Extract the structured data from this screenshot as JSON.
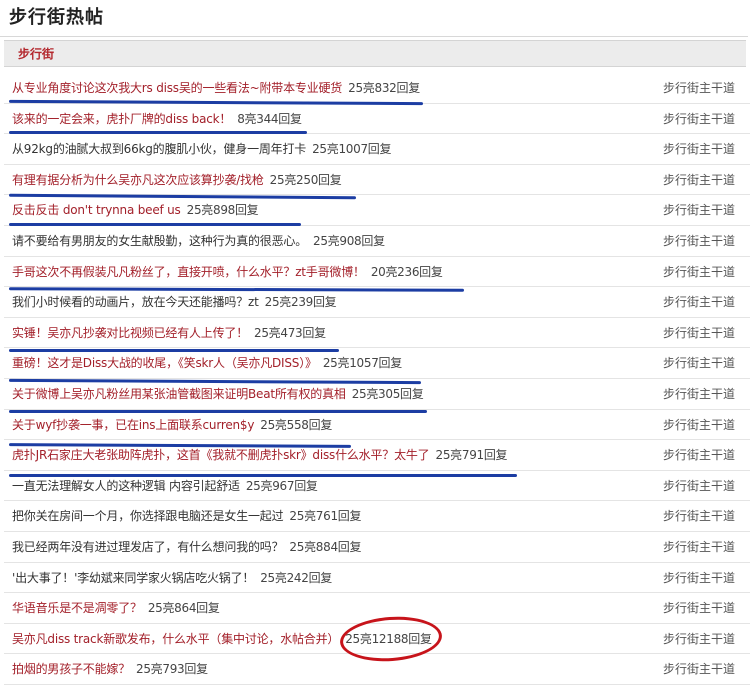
{
  "page": {
    "title": "步行街热帖"
  },
  "section": {
    "label": "步行街"
  },
  "posts": [
    {
      "title": "从专业角度讨论这次我大rs diss吴的一些看法~附带本专业硬货",
      "meta": "25亮832回复",
      "board": "步行街主干道",
      "color": "red"
    },
    {
      "title": "该来的一定会来，虎扑厂牌的diss back！",
      "meta": "8亮344回复",
      "board": "步行街主干道",
      "color": "red"
    },
    {
      "title": "从92kg的油腻大叔到66kg的腹肌小伙，健身一周年打卡",
      "meta": "25亮1007回复",
      "board": "步行街主干道",
      "color": "dark"
    },
    {
      "title": "有理有据分析为什么吴亦凡这次应该算抄袭/找枪",
      "meta": "25亮250回复",
      "board": "步行街主干道",
      "color": "red"
    },
    {
      "title": "反击反击 don't trynna beef us",
      "meta": "25亮898回复",
      "board": "步行街主干道",
      "color": "red"
    },
    {
      "title": "请不要给有男朋友的女生献殷勤，这种行为真的很恶心。",
      "meta": "25亮908回复",
      "board": "步行街主干道",
      "color": "dark"
    },
    {
      "title": "手哥这次不再假装凡凡粉丝了，直接开喷，什么水平？zt手哥微博！",
      "meta": "20亮236回复",
      "board": "步行街主干道",
      "color": "red"
    },
    {
      "title": "我们小时候看的动画片，放在今天还能播吗？zt",
      "meta": "25亮239回复",
      "board": "步行街主干道",
      "color": "dark"
    },
    {
      "title": "实锤！吴亦凡抄袭对比视频已经有人上传了！",
      "meta": "25亮473回复",
      "board": "步行街主干道",
      "color": "red"
    },
    {
      "title": "重磅！这才是Diss大战的收尾，《笑skr人（吴亦凡DISS）》",
      "meta": "25亮1057回复",
      "board": "步行街主干道",
      "color": "red"
    },
    {
      "title": "关于微博上吴亦凡粉丝用某张油管截图来证明Beat所有权的真相",
      "meta": "25亮305回复",
      "board": "步行街主干道",
      "color": "red"
    },
    {
      "title": "关于wyf抄袭一事，已在ins上面联系curren$y",
      "meta": "25亮558回复",
      "board": "步行街主干道",
      "color": "red"
    },
    {
      "title": "虎扑JR石家庄大老张助阵虎扑，这首《我就不删虎扑skr》diss什么水平？太牛了",
      "meta": "25亮791回复",
      "board": "步行街主干道",
      "color": "red"
    },
    {
      "title": "一直无法理解女人的这种逻辑 内容引起舒适",
      "meta": "25亮967回复",
      "board": "步行街主干道",
      "color": "dark"
    },
    {
      "title": "把你关在房间一个月，你选择跟电脑还是女生一起过",
      "meta": "25亮761回复",
      "board": "步行街主干道",
      "color": "dark"
    },
    {
      "title": "我已经两年没有进过理发店了，有什么想问我的吗？",
      "meta": "25亮884回复",
      "board": "步行街主干道",
      "color": "dark"
    },
    {
      "title": "'出大事了！'李幼斌来同学家火锅店吃火锅了！",
      "meta": "25亮242回复",
      "board": "步行街主干道",
      "color": "dark"
    },
    {
      "title": "华语音乐是不是凋零了？",
      "meta": "25亮864回复",
      "board": "步行街主干道",
      "color": "red"
    },
    {
      "title": "吴亦凡diss track新歌发布，什么水平（集中讨论，水帖合并）",
      "meta": "25亮12188回复",
      "board": "步行街主干道",
      "color": "red"
    },
    {
      "title": "拍烟的男孩子不能嫁？",
      "meta": "25亮793回复",
      "board": "步行街主干道",
      "color": "red"
    }
  ]
}
